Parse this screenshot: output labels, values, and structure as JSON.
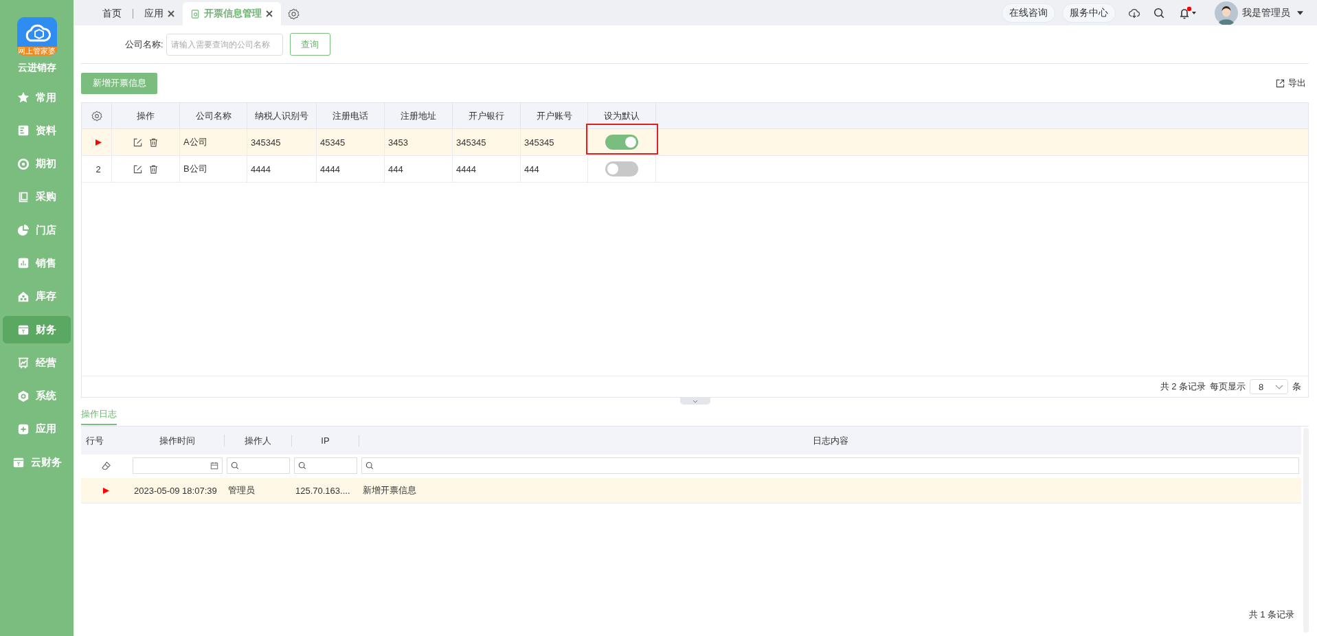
{
  "sidebar": {
    "brand": "云进销存",
    "logo_badge": "网上管家婆",
    "items": [
      {
        "label": "常用",
        "selected": false
      },
      {
        "label": "资料",
        "selected": false
      },
      {
        "label": "期初",
        "selected": false
      },
      {
        "label": "采购",
        "selected": false
      },
      {
        "label": "门店",
        "selected": false
      },
      {
        "label": "销售",
        "selected": false
      },
      {
        "label": "库存",
        "selected": false
      },
      {
        "label": "财务",
        "selected": true
      },
      {
        "label": "经营",
        "selected": false
      },
      {
        "label": "系统",
        "selected": false
      },
      {
        "label": "应用",
        "selected": false
      },
      {
        "label": "云财务",
        "selected": false
      }
    ]
  },
  "tabs": [
    {
      "label": "首页",
      "selected": false,
      "closable": false
    },
    {
      "label": "应用",
      "selected": false,
      "closable": true
    },
    {
      "label": "开票信息管理",
      "selected": true,
      "closable": true
    }
  ],
  "header": {
    "links": [
      "在线咨询",
      "服务中心"
    ],
    "notifications_unread": true,
    "user": "我是管理员"
  },
  "search": {
    "label": "公司名称:",
    "placeholder": "请输入需要查询的公司名称",
    "button": "查询"
  },
  "toolbar": {
    "add_button": "新增开票信息",
    "export": "导出"
  },
  "table": {
    "columns": [
      "操作",
      "公司名称",
      "纳税人识别号",
      "注册电话",
      "注册地址",
      "开户银行",
      "开户账号",
      "设为默认"
    ],
    "rows": [
      {
        "selected": true,
        "highlighted": true,
        "cells": [
          "",
          "A公司",
          "345345",
          "45345",
          "3453",
          "345345",
          "345345"
        ],
        "default": true
      },
      {
        "selected": false,
        "number": "2",
        "highlighted": false,
        "cells": [
          "",
          "B公司",
          "4444",
          "4444",
          "444",
          "4444",
          "444"
        ],
        "default": false
      }
    ],
    "footer": {
      "total": "共 2 条记录",
      "per_page_label": "每页显示",
      "per_page": "8",
      "unit": "条"
    }
  },
  "log": {
    "tab": "操作日志",
    "columns": [
      "行号",
      "操作时间",
      "操作人",
      "IP",
      "日志内容"
    ],
    "rows": [
      {
        "selected": true,
        "cells": [
          "",
          "2023-05-09 18:07:39",
          "管理员",
          "125.70.163....",
          "新增开票信息"
        ]
      }
    ],
    "footer": "共 1 条记录"
  }
}
